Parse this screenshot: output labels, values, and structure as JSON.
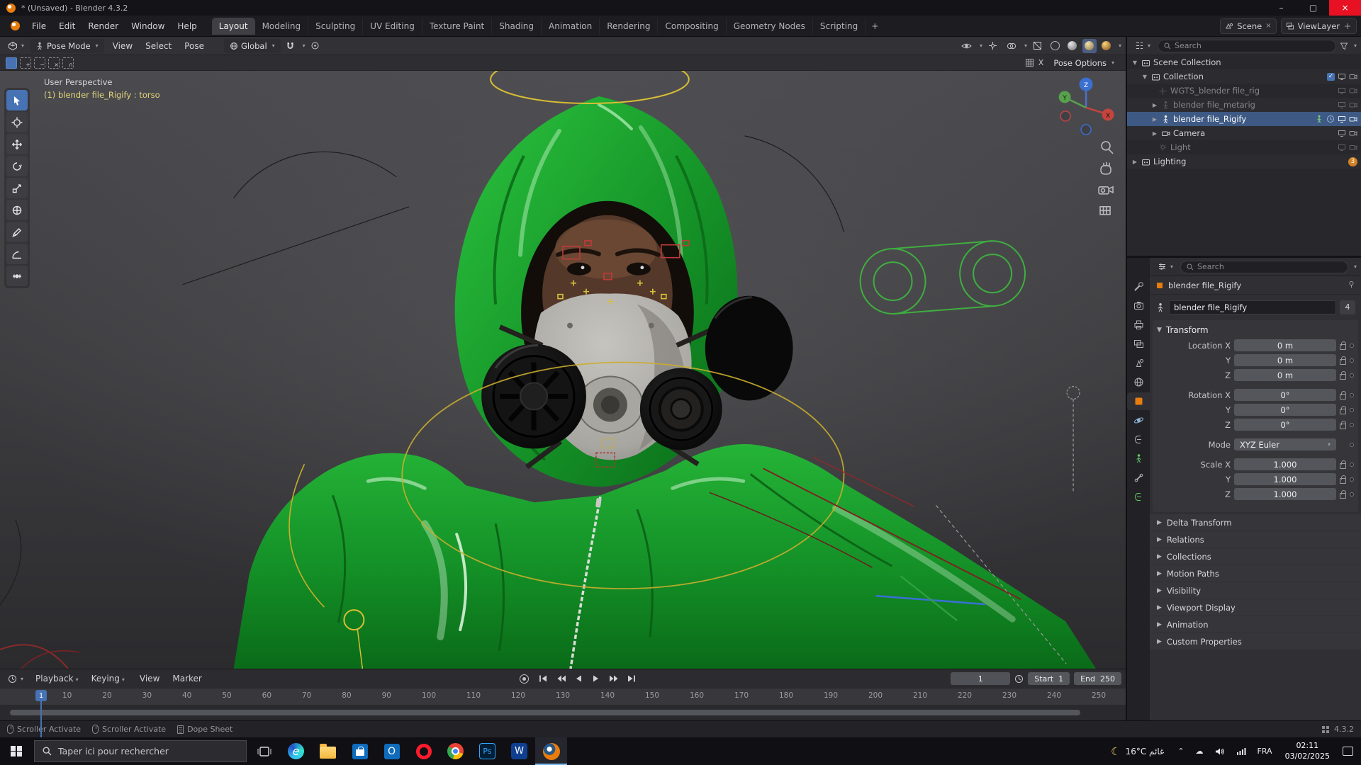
{
  "window": {
    "title": "* (Unsaved) - Blender 4.3.2"
  },
  "colors": {
    "accent": "#4772b3",
    "selection": "#3e5a84",
    "object_orange": "#e87d0d",
    "suit_green": "#1ea62e",
    "close_red": "#e81123"
  },
  "topbar": {
    "menus": [
      "File",
      "Edit",
      "Render",
      "Window",
      "Help"
    ],
    "workspaces": [
      {
        "label": "Layout",
        "cls": "active"
      },
      {
        "label": "Modeling"
      },
      {
        "label": "Sculpting"
      },
      {
        "label": "UV Editing"
      },
      {
        "label": "Texture Paint"
      },
      {
        "label": "Shading"
      },
      {
        "label": "Animation"
      },
      {
        "label": "Rendering"
      },
      {
        "label": "Compositing"
      },
      {
        "label": "Geometry Nodes"
      },
      {
        "label": "Scripting"
      }
    ],
    "add_tab": "+",
    "scene": "Scene",
    "viewlayer": "ViewLayer"
  },
  "header": {
    "mode": "Pose Mode",
    "menus": [
      "View",
      "Select",
      "Pose"
    ],
    "orientation": "Global",
    "mirror_x": "X",
    "pose_options": "Pose Options"
  },
  "viewport": {
    "perspective": "User Perspective",
    "active_object": "(1) blender file_Rigify : torso",
    "axis_z": "Z",
    "axis_y": "Y",
    "axis_x": "X"
  },
  "outliner": {
    "search": "Search",
    "rows": [
      {
        "label": "Scene Collection"
      },
      {
        "label": "Collection"
      },
      {
        "label": "WGTS_blender file_rig"
      },
      {
        "label": "blender file_metarig"
      },
      {
        "label": "blender file_Rigify"
      },
      {
        "label": "Camera"
      },
      {
        "label": "Light"
      },
      {
        "label": "Lighting",
        "badge": "3"
      }
    ]
  },
  "properties": {
    "search": "Search",
    "breadcrumb": "blender file_Rigify",
    "name": "blender file_Rigify",
    "users": "4",
    "transform_title": "Transform",
    "location": [
      {
        "label": "Location X",
        "value": "0 m"
      },
      {
        "label": "Y",
        "value": "0 m"
      },
      {
        "label": "Z",
        "value": "0 m"
      }
    ],
    "rotation": [
      {
        "label": "Rotation X",
        "value": "0°"
      },
      {
        "label": "Y",
        "value": "0°"
      },
      {
        "label": "Z",
        "value": "0°"
      }
    ],
    "mode_label": "Mode",
    "mode_value": "XYZ Euler",
    "scale": [
      {
        "label": "Scale X",
        "value": "1.000"
      },
      {
        "label": "Y",
        "value": "1.000"
      },
      {
        "label": "Z",
        "value": "1.000"
      }
    ],
    "panels": [
      "Delta Transform",
      "Relations",
      "Collections",
      "Motion Paths",
      "Visibility",
      "Viewport Display",
      "Animation",
      "Custom Properties"
    ]
  },
  "timeline": {
    "menus_dd": [
      "Playback",
      "Keying"
    ],
    "menus": [
      "View",
      "Marker"
    ],
    "current": "1",
    "start_label": "Start",
    "start": "1",
    "end_label": "End",
    "end": "250",
    "ruler": [
      "10",
      "20",
      "30",
      "40",
      "50",
      "60",
      "70",
      "80",
      "90",
      "100",
      "110",
      "120",
      "130",
      "140",
      "150",
      "160",
      "170",
      "180",
      "190",
      "200",
      "210",
      "220",
      "230",
      "240",
      "250"
    ]
  },
  "statusbar": {
    "hints": [
      "Scroller Activate",
      "Scroller Activate",
      "Dope Sheet"
    ],
    "version": "4.3.2"
  },
  "taskbar": {
    "search": "Taper ici pour rechercher",
    "weather": "16°C غائم",
    "lang": "FRA",
    "time": "02:11",
    "date": "03/02/2025",
    "apps": [
      "edge",
      "file-explorer",
      "store",
      "outlook",
      "opera",
      "chrome",
      "photoshop",
      "word",
      "blender"
    ]
  }
}
